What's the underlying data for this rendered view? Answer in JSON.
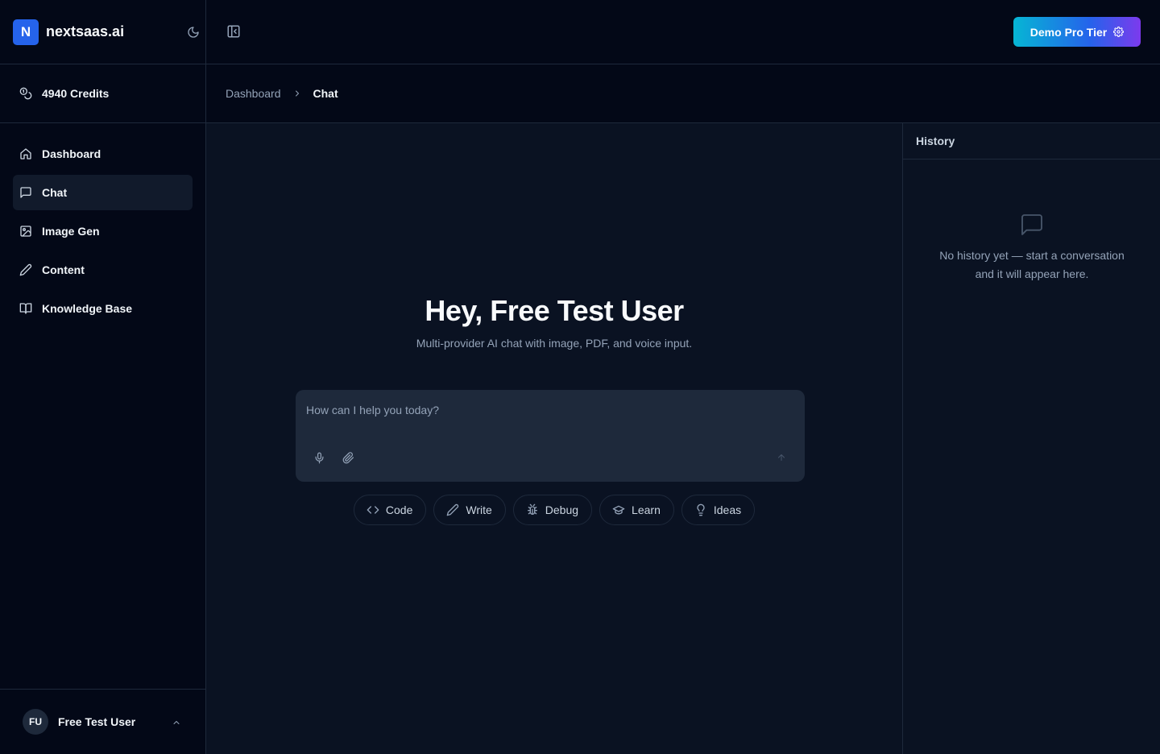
{
  "brand": {
    "logo_letter": "N",
    "name": "nextsaas.ai",
    "theme_icon": "moon-icon"
  },
  "credits": {
    "label": "4940 Credits",
    "icon": "coins-icon"
  },
  "sidebar": {
    "items": [
      {
        "label": "Dashboard",
        "icon": "home-icon",
        "active": false
      },
      {
        "label": "Chat",
        "icon": "message-square-icon",
        "active": true
      },
      {
        "label": "Image Gen",
        "icon": "image-icon",
        "active": false
      },
      {
        "label": "Content",
        "icon": "pencil-icon",
        "active": false
      },
      {
        "label": "Knowledge Base",
        "icon": "book-open-icon",
        "active": false
      }
    ]
  },
  "user": {
    "initials": "FU",
    "name": "Free Test User"
  },
  "topbar": {
    "pro_button_label": "Demo Pro Tier"
  },
  "breadcrumb": {
    "parent": "Dashboard",
    "current": "Chat"
  },
  "main": {
    "title": "Hey, Free Test User",
    "subtitle": "Multi-provider AI chat with image, PDF, and voice input.",
    "input_placeholder": "How can I help you today?",
    "input_value": "",
    "chips": [
      {
        "label": "Code",
        "icon": "code-icon"
      },
      {
        "label": "Write",
        "icon": "pencil-icon"
      },
      {
        "label": "Debug",
        "icon": "bug-icon"
      },
      {
        "label": "Learn",
        "icon": "graduation-cap-icon"
      },
      {
        "label": "Ideas",
        "icon": "lightbulb-icon"
      }
    ]
  },
  "history": {
    "title": "History",
    "empty_line1": "No history yet — start a conversation",
    "empty_line2": "and it will appear here."
  },
  "colors": {
    "background": "#030817",
    "panel": "#0a1222",
    "input": "#1e293b",
    "accent_start": "#06b6d4",
    "accent_mid": "#2563eb",
    "accent_end": "#7c3aed",
    "logo": "#2563eb"
  }
}
